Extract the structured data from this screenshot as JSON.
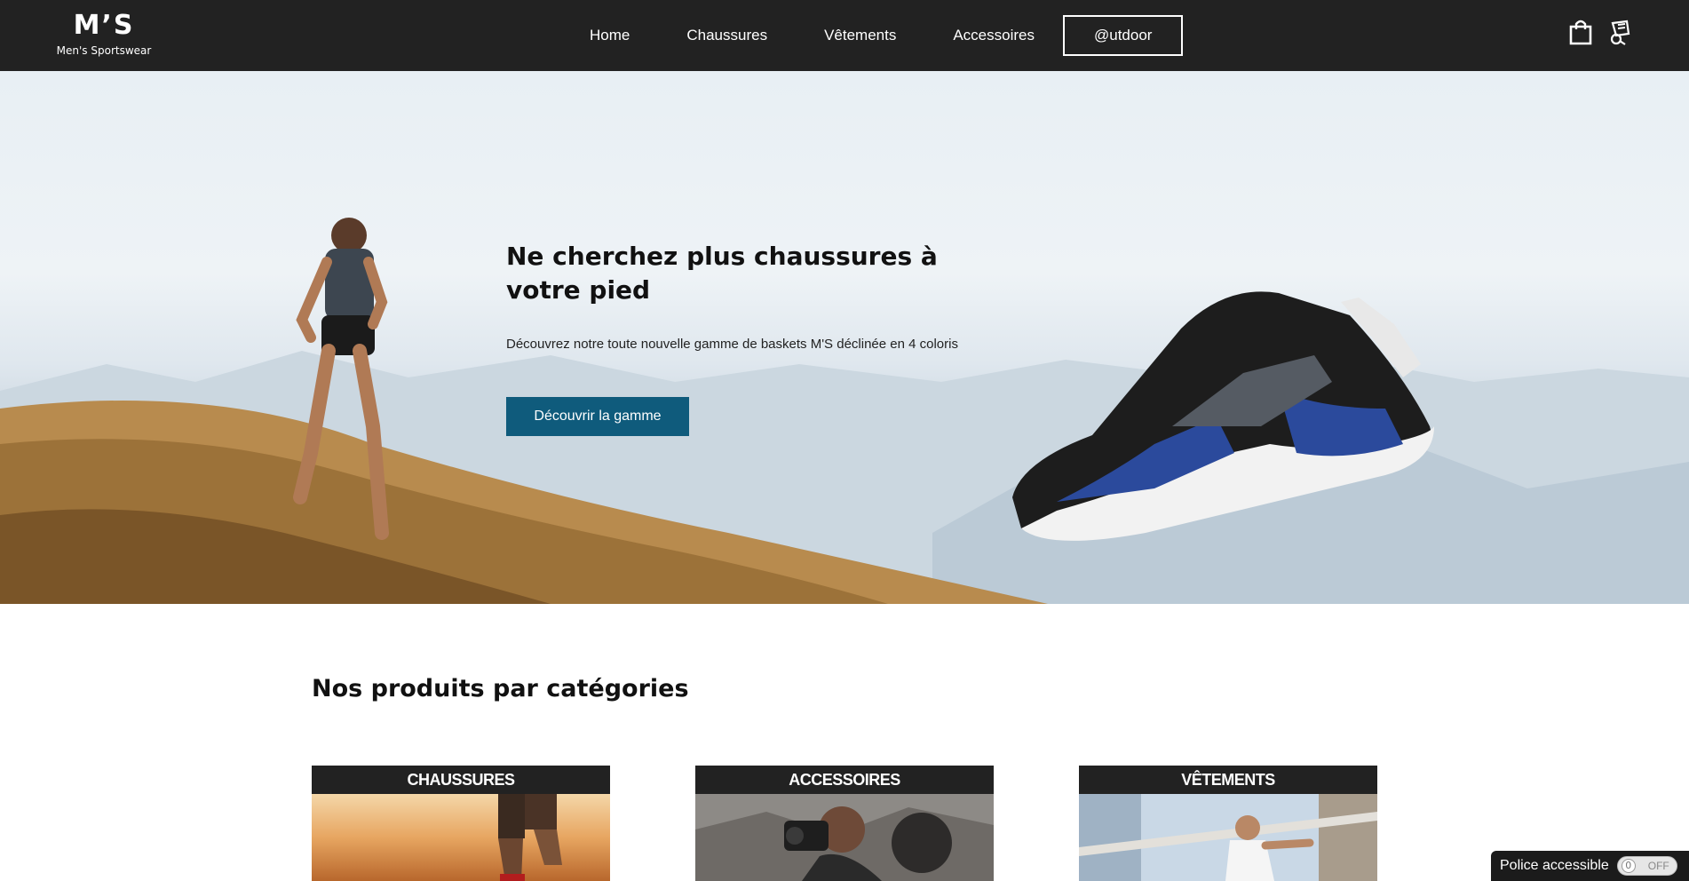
{
  "header": {
    "logo_mark": "M’S",
    "logo_tagline": "Men's Sportswear",
    "nav": [
      {
        "label": "Home"
      },
      {
        "label": "Chaussures"
      },
      {
        "label": "Vêtements"
      },
      {
        "label": "Accessoires"
      },
      {
        "label": "@utdoor"
      }
    ],
    "icons": [
      "shopping-bag-icon",
      "accessibility-icon"
    ]
  },
  "hero": {
    "title": "Ne cherchez plus chaussures à votre pied",
    "text": "Découvrez notre toute nouvelle gamme de baskets M'S déclinée en 4 coloris",
    "button_label": "Découvrir la gamme"
  },
  "categories": {
    "title": "Nos produits par catégories",
    "items": [
      {
        "label": "CHAUSSURES"
      },
      {
        "label": "ACCESSOIRES"
      },
      {
        "label": "VÊTEMENTS"
      }
    ]
  },
  "accessibility": {
    "label": "Police accessible",
    "knob": "0",
    "state": "OFF"
  },
  "colors": {
    "header_bg": "#222222",
    "button_bg": "#0f5b7c",
    "shoe_blue": "#2b4a9c"
  }
}
